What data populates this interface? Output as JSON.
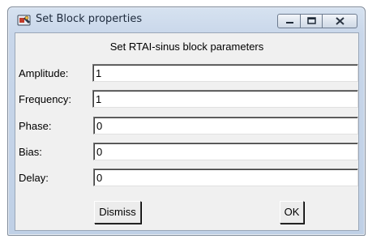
{
  "window": {
    "title": "Set Block properties",
    "icon": "app-settings-icon"
  },
  "titlebar_buttons": {
    "minimize_icon": "minimize-icon",
    "maximize_icon": "maximize-icon",
    "close_icon": "close-icon"
  },
  "dialog": {
    "subtitle": "Set RTAI-sinus block parameters",
    "fields": [
      {
        "label": "Amplitude:",
        "value": "1"
      },
      {
        "label": "Frequency:",
        "value": "1"
      },
      {
        "label": "Phase:",
        "value": "0"
      },
      {
        "label": "Bias:",
        "value": "0"
      },
      {
        "label": "Delay:",
        "value": "0"
      }
    ],
    "dismiss_label": "Dismiss",
    "ok_label": "OK"
  }
}
